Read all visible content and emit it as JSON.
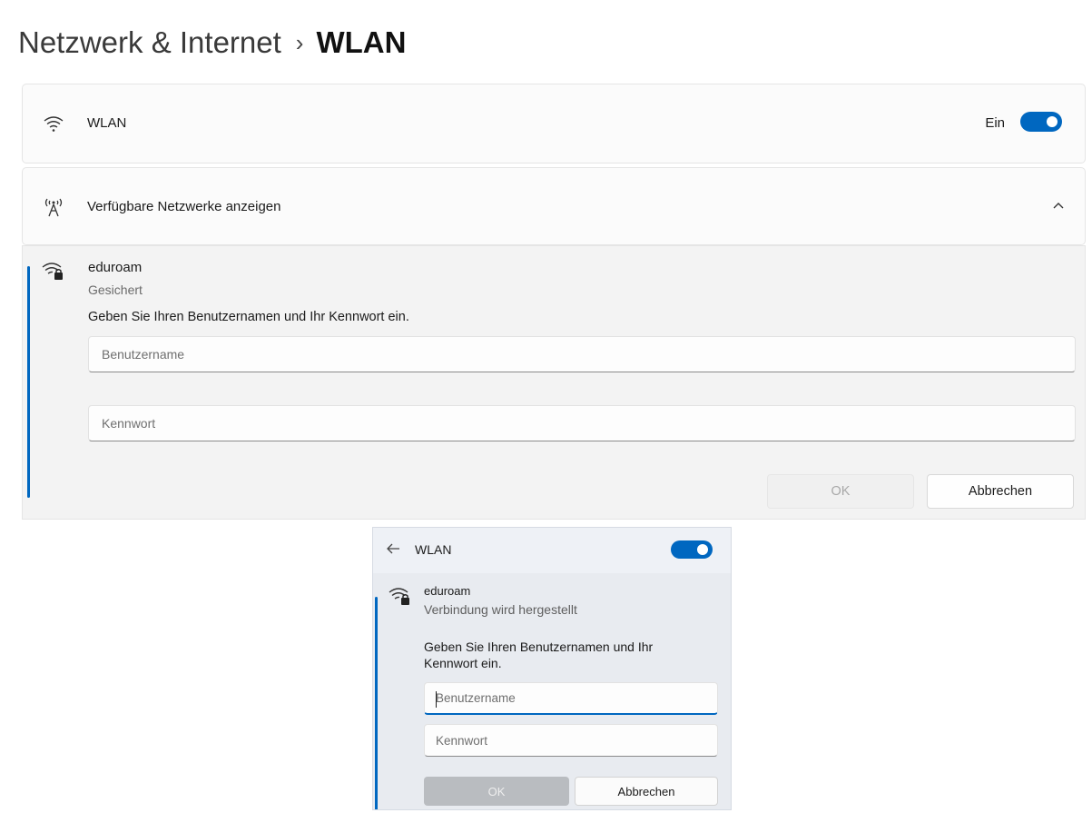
{
  "settings": {
    "breadcrumb": {
      "parent": "Netzwerk & Internet",
      "separator": "›",
      "current": "WLAN"
    },
    "wlan_row": {
      "label": "WLAN",
      "toggle_text": "Ein",
      "toggle_on": true
    },
    "available_row": {
      "label": "Verfügbare Netzwerke anzeigen",
      "expanded": true
    },
    "network": {
      "name": "eduroam",
      "status": "Gesichert",
      "prompt": "Geben Sie Ihren Benutzernamen und Ihr Kennwort ein.",
      "username_placeholder": "Benutzername",
      "password_placeholder": "Kennwort",
      "ok_label": "OK",
      "cancel_label": "Abbrechen"
    }
  },
  "flyout": {
    "title": "WLAN",
    "toggle_on": true,
    "network": {
      "name": "eduroam",
      "status": "Verbindung wird hergestellt",
      "prompt": "Geben Sie Ihren Benutzernamen und Ihr Kennwort ein.",
      "username_placeholder": "Benutzername",
      "password_placeholder": "Kennwort",
      "ok_label": "OK",
      "cancel_label": "Abbrechen"
    }
  },
  "icons": {
    "wifi": "wifi-icon",
    "antenna": "antenna-icon",
    "wifi_secured": "wifi-lock-icon",
    "chevron": "chevron-up-icon",
    "back": "back-arrow-icon"
  },
  "colors": {
    "accent": "#0067c0"
  }
}
